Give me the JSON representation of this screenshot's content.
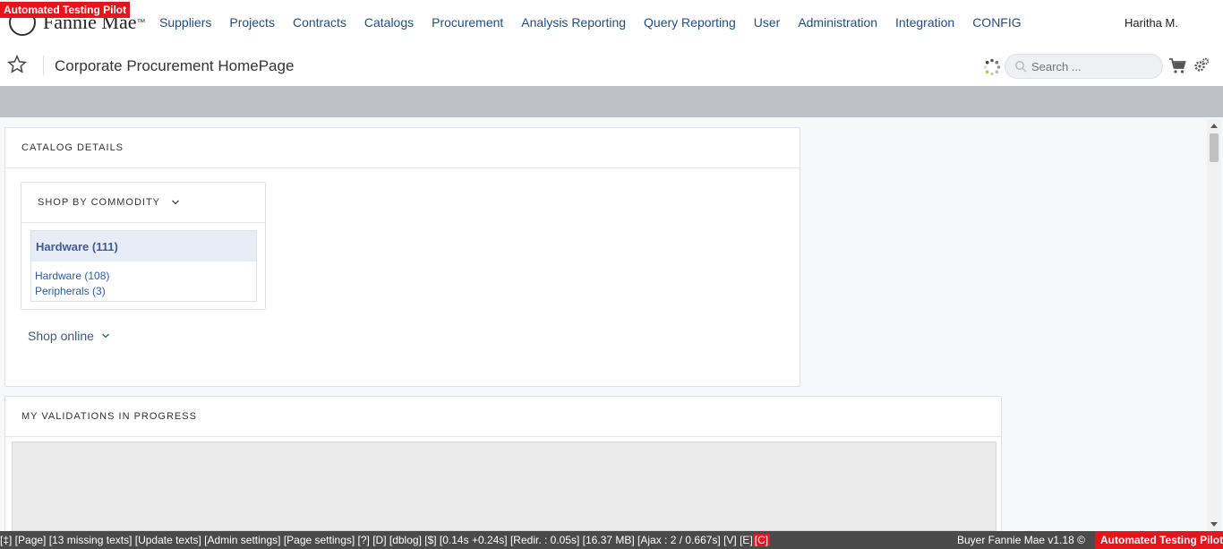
{
  "badges": {
    "automation": "Automated Testing Pilot"
  },
  "brand": {
    "name": "Fannie Mae",
    "trademark": "™"
  },
  "nav": {
    "items": [
      {
        "label": "Suppliers"
      },
      {
        "label": "Projects"
      },
      {
        "label": "Contracts"
      },
      {
        "label": "Catalogs"
      },
      {
        "label": "Procurement"
      },
      {
        "label": "Analysis Reporting"
      },
      {
        "label": "Query Reporting"
      },
      {
        "label": "User"
      },
      {
        "label": "Administration"
      },
      {
        "label": "Integration"
      },
      {
        "label": "CONFIG"
      }
    ],
    "user_name": "Haritha M."
  },
  "header": {
    "page_title": "Corporate Procurement HomePage",
    "search_placeholder": "Search ..."
  },
  "catalog_panel": {
    "title": "CATALOG DETAILS",
    "commodity": {
      "title": "SHOP BY COMMODITY",
      "selected": "Hardware (111)",
      "children": [
        "Hardware (108)",
        "Peripherals (3)"
      ]
    },
    "shop_online": "Shop online"
  },
  "validations_panel": {
    "title": "MY VALIDATIONS IN PROGRESS"
  },
  "footer": {
    "debug": "[‡] [Page] [13 missing texts] [Update texts] [Admin settings] [Page settings] [?] [D] [dblog] [$] [0.14s +0.24s] [Redir. : 0.05s] [16.37 MB] [Ajax : 2 / 0.667s] [V] [E] ",
    "c_flag": "[C]",
    "version": "Buyer Fannie Mae v1.18 ©",
    "automation": "Automated Testing Pilot"
  },
  "colors": {
    "nav_link": "#1f4e8c",
    "alert_red": "#e8141c",
    "grey_band": "#bdc1c6"
  },
  "icons": [
    "star-icon",
    "spinner-icon",
    "search-icon",
    "cart-icon",
    "gear-icon",
    "chevron-down-icon"
  ]
}
